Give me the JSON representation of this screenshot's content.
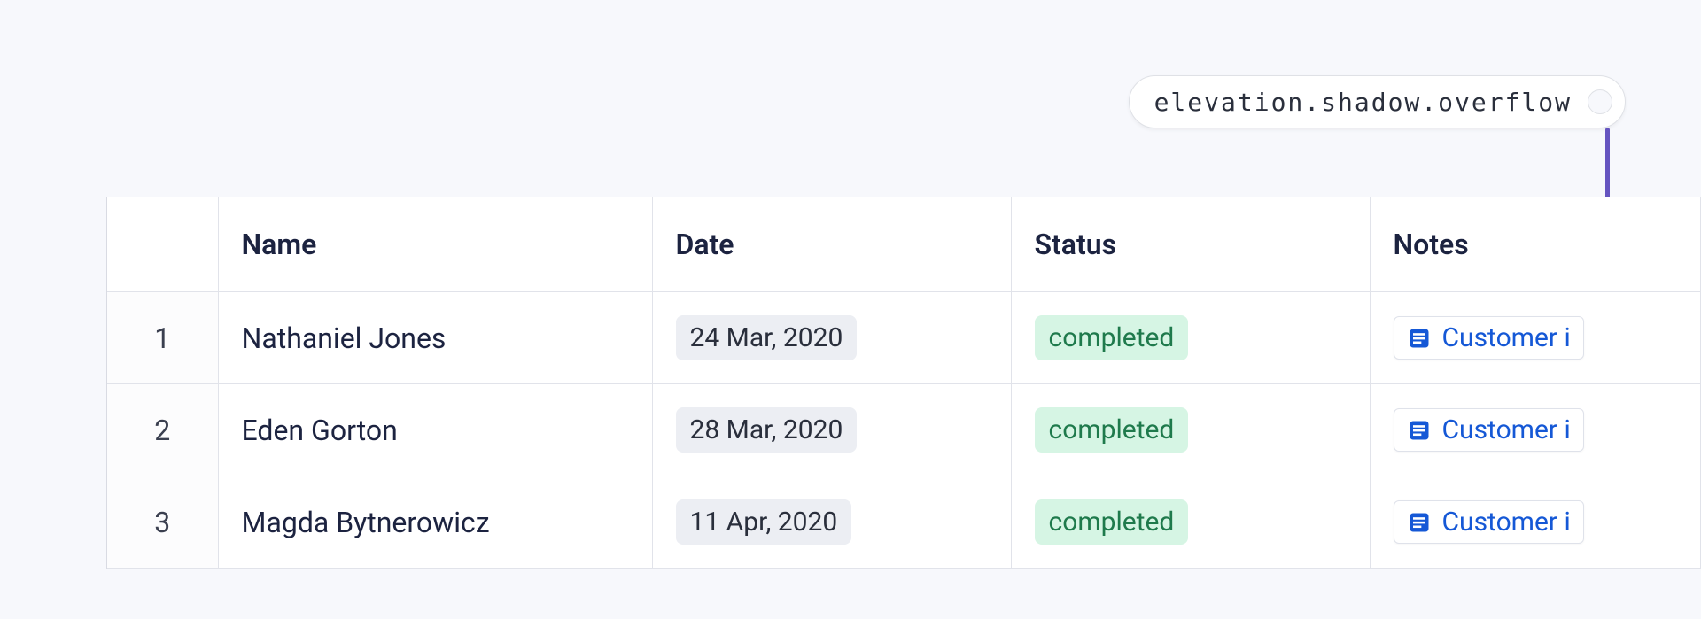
{
  "token_pill": {
    "label": "elevation.shadow.overflow",
    "connector_color": "#6554c0"
  },
  "table": {
    "headers": {
      "index": "",
      "name": "Name",
      "date": "Date",
      "status": "Status",
      "notes": "Notes"
    },
    "rows": [
      {
        "index": "1",
        "name": "Nathaniel Jones",
        "date": "24 Mar, 2020",
        "status": "completed",
        "note": "Customer i"
      },
      {
        "index": "2",
        "name": "Eden Gorton",
        "date": "28 Mar, 2020",
        "status": "completed",
        "note": "Customer i"
      },
      {
        "index": "3",
        "name": "Magda Bytnerowicz",
        "date": "11 Apr, 2020",
        "status": "completed",
        "note": "Customer i"
      }
    ]
  }
}
